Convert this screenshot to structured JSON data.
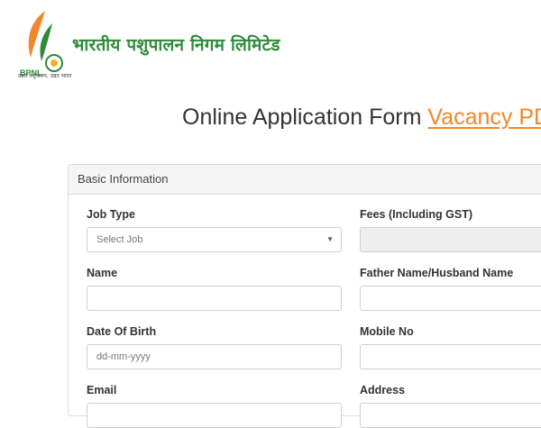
{
  "header": {
    "org_name": "भारतीय पशुपालन निगम लिमिटेड",
    "logo_text": "BPNL",
    "tagline": "उन्नत पशुपालन, उन्नत भारत",
    "colors": {
      "green": "#2f8a3a",
      "orange": "#f0872b"
    }
  },
  "page": {
    "title": "Online Application Form",
    "vacancy_link": "Vacancy PDF"
  },
  "form": {
    "section_title": "Basic Information",
    "fields": {
      "job_type": {
        "label": "Job Type",
        "placeholder": "Select Job"
      },
      "fees": {
        "label": "Fees (Including GST)",
        "value": ""
      },
      "name": {
        "label": "Name",
        "value": ""
      },
      "father_name": {
        "label": "Father Name/Husband Name",
        "value": ""
      },
      "dob": {
        "label": "Date Of Birth",
        "placeholder": "dd-mm-yyyy"
      },
      "mobile": {
        "label": "Mobile No",
        "value": ""
      },
      "email": {
        "label": "Email",
        "value": ""
      },
      "address": {
        "label": "Address",
        "value": ""
      }
    }
  }
}
